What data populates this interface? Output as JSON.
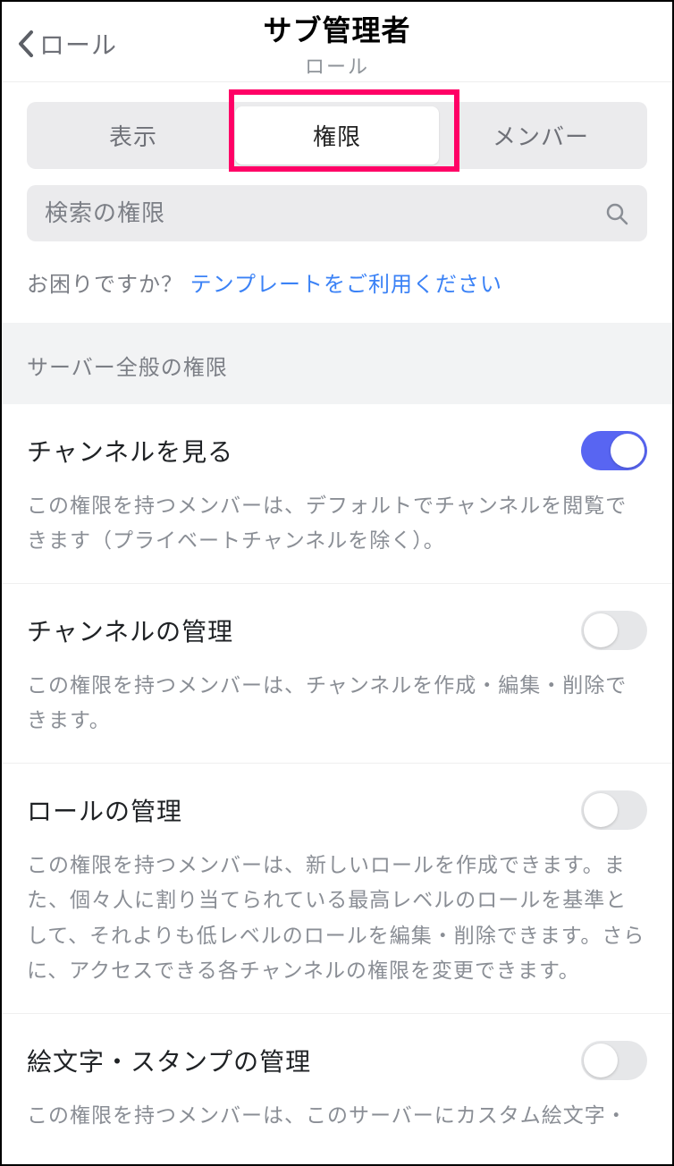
{
  "header": {
    "back_label": "ロール",
    "title": "サブ管理者",
    "subtitle": "ロール"
  },
  "tabs": {
    "display": "表示",
    "permissions": "権限",
    "members": "メンバー",
    "active": "permissions"
  },
  "search": {
    "placeholder": "検索の権限",
    "icon": "search-icon"
  },
  "help": {
    "prefix": "お困りですか？",
    "link": "テンプレートをご利用ください"
  },
  "section_header": "サーバー全般の権限",
  "permissions": [
    {
      "title": "チャンネルを見る",
      "desc": "この権限を持つメンバーは、デフォルトでチャンネルを閲覧できます（プライベートチャンネルを除く）。",
      "enabled": true
    },
    {
      "title": "チャンネルの管理",
      "desc": "この権限を持つメンバーは、チャンネルを作成・編集・削除できます。",
      "enabled": false
    },
    {
      "title": "ロールの管理",
      "desc": "この権限を持つメンバーは、新しいロールを作成できます。また、個々人に割り当てられている最高レベルのロールを基準として、それよりも低レベルのロールを編集・削除できます。さらに、アクセスできる各チャンネルの権限を変更できます。",
      "enabled": false
    },
    {
      "title": "絵文字・スタンプの管理",
      "desc": "この権限を持つメンバーは、このサーバーにカスタム絵文字・",
      "enabled": false
    }
  ]
}
